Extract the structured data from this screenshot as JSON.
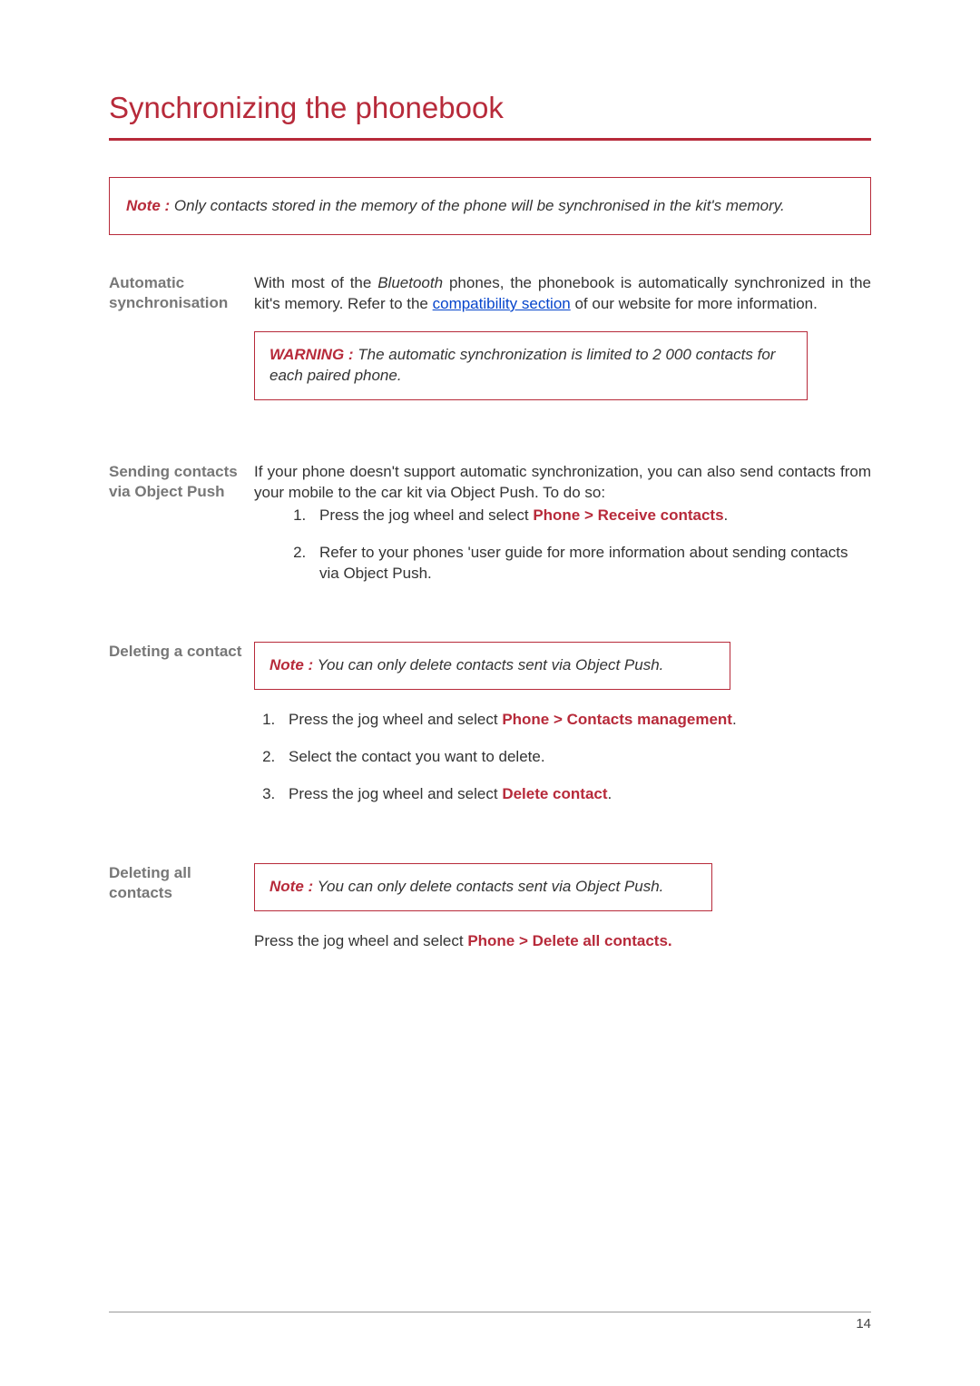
{
  "title": "Synchronizing the phonebook",
  "top_note": {
    "label": "Note :",
    "text": " Only contacts stored in the memory of the phone will be synchronised in the kit's memory."
  },
  "sections": {
    "s1": {
      "label": "Automatic synchronisation",
      "para_before": "With most of the ",
      "bluetooth": "Bluetooth",
      "para_mid": " phones, the phonebook is automatically synchronized in the kit's memory. Refer to the ",
      "link_text": "compatibility section",
      "para_after": " of our website for more information.",
      "warn_label": "WARNING :",
      "warn_text": "  The automatic synchronization is limited to 2 000 contacts for each paired phone."
    },
    "s2": {
      "label": "Sending contacts via Object Push",
      "intro": "If your phone doesn't support automatic synchronization, you can also send contacts from your mobile to the car kit via Object Push. To do so:",
      "li1_pre": "Press the jog wheel and select ",
      "li1_red": "Phone > Receive contacts",
      "li1_post": ".",
      "li2": "Refer to your phones 'user guide for more information about sending contacts via Object Push."
    },
    "s3": {
      "label": "Deleting a contact",
      "note_label": "Note :",
      "note_text": " You can only delete contacts sent via Object Push.",
      "li1_pre": "Press the jog wheel and select ",
      "li1_red": "Phone > Contacts management",
      "li1_post": ".",
      "li2": "Select the contact you want to delete.",
      "li3_pre": "Press the jog wheel and select ",
      "li3_red": "Delete contact",
      "li3_post": "."
    },
    "s4": {
      "label": "Deleting all contacts",
      "note_label": "Note :",
      "note_text": "  You can only delete contacts sent via Object Push.",
      "final_pre": "Press the jog wheel and select ",
      "final_red": "Phone > Delete all contacts.",
      "final_post": ""
    }
  },
  "page_number": "14"
}
